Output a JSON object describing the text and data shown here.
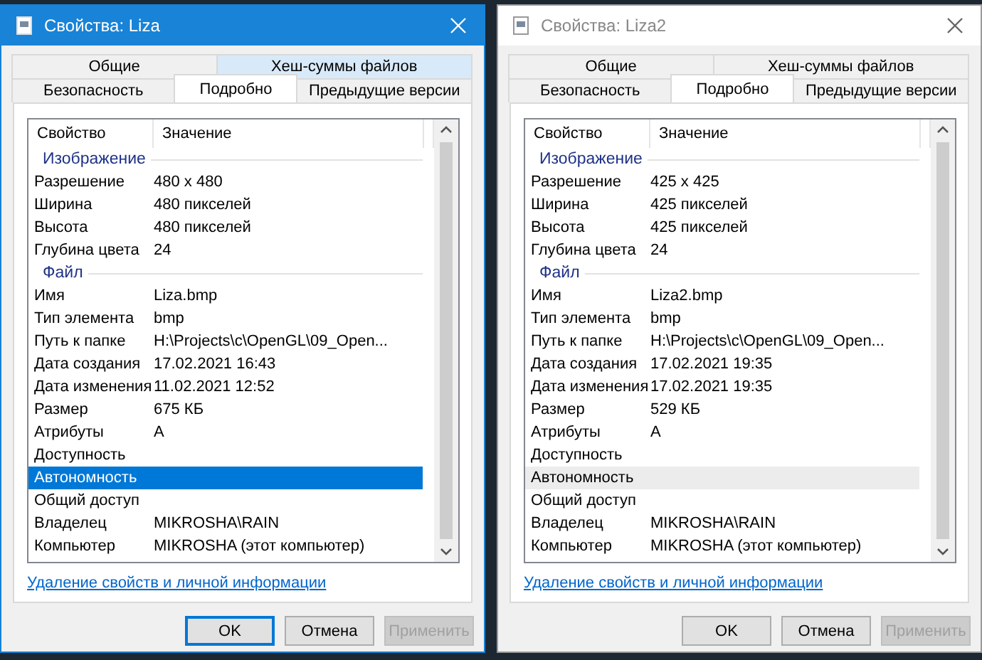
{
  "windows": [
    {
      "title": "Свойства: Liza",
      "active": true,
      "tab_rows": [
        [
          {
            "label": "Общие",
            "selected": false,
            "hovered": false
          },
          {
            "label": "Хеш-суммы файлов",
            "selected": false,
            "hovered": true
          }
        ],
        [
          {
            "label": "Безопасность",
            "selected": false,
            "hovered": false
          },
          {
            "label": "Подробно",
            "selected": true,
            "hovered": false
          },
          {
            "label": "Предыдущие версии",
            "selected": false,
            "hovered": false
          }
        ]
      ],
      "columns": [
        "Свойство",
        "Значение"
      ],
      "groups": [
        {
          "title": "Изображение",
          "rows": [
            {
              "name": "Разрешение",
              "value": "480 x 480",
              "selected": false,
              "hovered": false
            },
            {
              "name": "Ширина",
              "value": "480 пикселей",
              "selected": false,
              "hovered": false
            },
            {
              "name": "Высота",
              "value": "480 пикселей",
              "selected": false,
              "hovered": false
            },
            {
              "name": "Глубина цвета",
              "value": "24",
              "selected": false,
              "hovered": false
            }
          ]
        },
        {
          "title": "Файл",
          "rows": [
            {
              "name": "Имя",
              "value": "Liza.bmp",
              "selected": false,
              "hovered": false
            },
            {
              "name": "Тип элемента",
              "value": "bmp",
              "selected": false,
              "hovered": false
            },
            {
              "name": "Путь к папке",
              "value": "H:\\Projects\\c\\OpenGL\\09_Open...",
              "selected": false,
              "hovered": false
            },
            {
              "name": "Дата создания",
              "value": "17.02.2021 16:43",
              "selected": false,
              "hovered": false
            },
            {
              "name": "Дата изменения",
              "value": "11.02.2021 12:52",
              "selected": false,
              "hovered": false
            },
            {
              "name": "Размер",
              "value": "675 КБ",
              "selected": false,
              "hovered": false
            },
            {
              "name": "Атрибуты",
              "value": "A",
              "selected": false,
              "hovered": false
            },
            {
              "name": "Доступность",
              "selected": false,
              "hovered": false
            },
            {
              "name": "Автономность",
              "selected": true,
              "hovered": false
            },
            {
              "name": "Общий доступ",
              "selected": false,
              "hovered": false
            },
            {
              "name": "Владелец",
              "value": "MIKROSHA\\RAIN",
              "selected": false,
              "hovered": false
            },
            {
              "name": "Компьютер",
              "value": "MIKROSHA (этот компьютер)",
              "selected": false,
              "hovered": false
            }
          ]
        }
      ],
      "link": "Удаление свойств и личной информации",
      "buttons": [
        {
          "label": "OK",
          "focused": true,
          "disabled": false
        },
        {
          "label": "Отмена",
          "focused": false,
          "disabled": false
        },
        {
          "label": "Применить",
          "focused": false,
          "disabled": true
        }
      ]
    },
    {
      "title": "Свойства: Liza2",
      "active": false,
      "tab_rows": [
        [
          {
            "label": "Общие",
            "selected": false,
            "hovered": false
          },
          {
            "label": "Хеш-суммы файлов",
            "selected": false,
            "hovered": false
          }
        ],
        [
          {
            "label": "Безопасность",
            "selected": false,
            "hovered": false
          },
          {
            "label": "Подробно",
            "selected": true,
            "hovered": false
          },
          {
            "label": "Предыдущие версии",
            "selected": false,
            "hovered": false
          }
        ]
      ],
      "columns": [
        "Свойство",
        "Значение"
      ],
      "groups": [
        {
          "title": "Изображение",
          "rows": [
            {
              "name": "Разрешение",
              "value": "425 x 425",
              "selected": false,
              "hovered": false
            },
            {
              "name": "Ширина",
              "value": "425 пикселей",
              "selected": false,
              "hovered": false
            },
            {
              "name": "Высота",
              "value": "425 пикселей",
              "selected": false,
              "hovered": false
            },
            {
              "name": "Глубина цвета",
              "value": "24",
              "selected": false,
              "hovered": false
            }
          ]
        },
        {
          "title": "Файл",
          "rows": [
            {
              "name": "Имя",
              "value": "Liza2.bmp",
              "selected": false,
              "hovered": false
            },
            {
              "name": "Тип элемента",
              "value": "bmp",
              "selected": false,
              "hovered": false
            },
            {
              "name": "Путь к папке",
              "value": "H:\\Projects\\c\\OpenGL\\09_Open...",
              "selected": false,
              "hovered": false
            },
            {
              "name": "Дата создания",
              "value": "17.02.2021 19:35",
              "selected": false,
              "hovered": false
            },
            {
              "name": "Дата изменения",
              "value": "17.02.2021 19:35",
              "selected": false,
              "hovered": false
            },
            {
              "name": "Размер",
              "value": "529 КБ",
              "selected": false,
              "hovered": false
            },
            {
              "name": "Атрибуты",
              "value": "A",
              "selected": false,
              "hovered": false
            },
            {
              "name": "Доступность",
              "selected": false,
              "hovered": false
            },
            {
              "name": "Автономность",
              "selected": false,
              "hovered": true
            },
            {
              "name": "Общий доступ",
              "selected": false,
              "hovered": false
            },
            {
              "name": "Владелец",
              "value": "MIKROSHA\\RAIN",
              "selected": false,
              "hovered": false
            },
            {
              "name": "Компьютер",
              "value": "MIKROSHA (этот компьютер)",
              "selected": false,
              "hovered": false
            }
          ]
        }
      ],
      "link": "Удаление свойств и личной информации",
      "buttons": [
        {
          "label": "OK",
          "focused": false,
          "disabled": false
        },
        {
          "label": "Отмена",
          "focused": false,
          "disabled": false
        },
        {
          "label": "Применить",
          "focused": false,
          "disabled": true
        }
      ]
    }
  ]
}
